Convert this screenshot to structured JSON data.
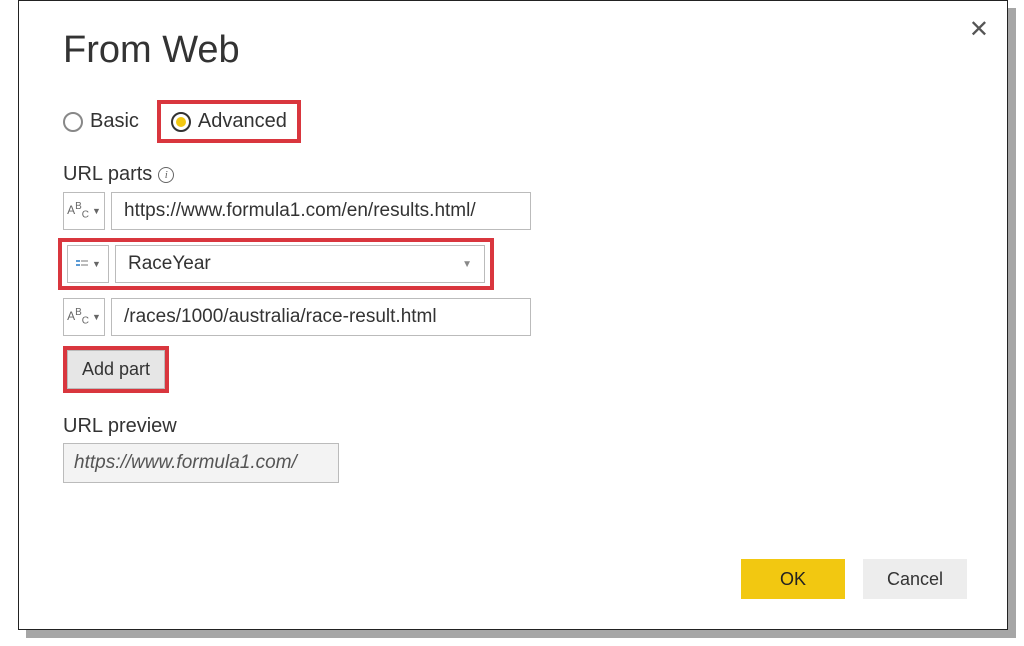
{
  "dialog": {
    "title": "From Web",
    "radios": {
      "basic": "Basic",
      "advanced": "Advanced",
      "selected": "advanced"
    },
    "urlPartsLabel": "URL parts",
    "parts": [
      {
        "typeIcon": "abc",
        "value": "https://www.formula1.com/en/results.html/"
      },
      {
        "typeIcon": "param",
        "value": "RaceYear"
      },
      {
        "typeIcon": "abc",
        "value": "/races/1000/australia/race-result.html"
      }
    ],
    "addPartLabel": "Add part",
    "previewLabel": "URL preview",
    "previewValue": "https://www.formula1.com/",
    "buttons": {
      "ok": "OK",
      "cancel": "Cancel"
    }
  }
}
